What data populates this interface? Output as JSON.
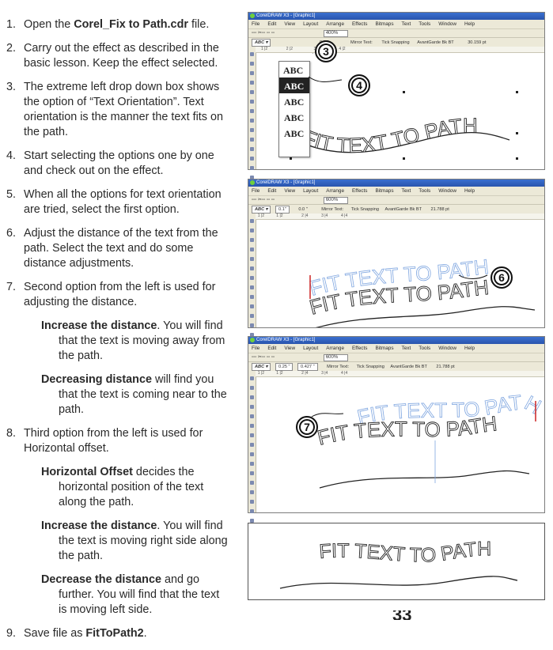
{
  "steps": [
    {
      "num": "1.",
      "parts": [
        {
          "t": "Open the "
        },
        {
          "t": "Corel_Fix to Path.cdr",
          "b": true
        },
        {
          "t": " file."
        }
      ]
    },
    {
      "num": "2.",
      "parts": [
        {
          "t": "Carry out the effect as described in the basic lesson. Keep the effect selected."
        }
      ]
    },
    {
      "num": "3.",
      "parts": [
        {
          "t": "The extreme left drop down box shows the option of “Text Orientation”. Text orientation is the manner the text fits on the path."
        }
      ]
    },
    {
      "num": "4.",
      "parts": [
        {
          "t": "Start selecting the options one by one and check out on the effect."
        }
      ]
    },
    {
      "num": "5.",
      "parts": [
        {
          "t": "When all the options for text orientation are tried, select the first option."
        }
      ]
    },
    {
      "num": "6.",
      "parts": [
        {
          "t": "Adjust the distance of the text from the path. Select the text and do some distance adjustments."
        }
      ]
    },
    {
      "num": "7.",
      "parts": [
        {
          "t": "Second option from the left is used for adjusting the distance."
        }
      ],
      "subs": [
        [
          {
            "t": "Increase the distance",
            "b": true
          },
          {
            "t": ". You will find that the text is moving away from the path."
          }
        ],
        [
          {
            "t": "Decreasing distance",
            "b": true
          },
          {
            "t": " will find you that the text is coming near to the path."
          }
        ]
      ]
    },
    {
      "num": "8.",
      "parts": [
        {
          "t": "Third option from the left is used for Horizontal offset."
        }
      ],
      "subs": [
        [
          {
            "t": "Horizontal Offset",
            "b": true
          },
          {
            "t": " decides the horizontal position of the text along the path."
          }
        ],
        [
          {
            "t": "Increase the distance",
            "b": true
          },
          {
            "t": ". You will find the text is moving right side along the path."
          }
        ],
        [
          {
            "t": "Decrease the distance",
            "b": true
          },
          {
            "t": " and go further. You will find that the text is moving left side."
          }
        ]
      ]
    },
    {
      "num": "9.",
      "parts": [
        {
          "t": "Save file as "
        },
        {
          "t": "FitToPath2",
          "b": true
        },
        {
          "t": "."
        }
      ]
    }
  ],
  "app": {
    "title": "CorelDRAW X3 - [Graphic1]",
    "menu": [
      "File",
      "Edit",
      "View",
      "Layout",
      "Arrange",
      "Effects",
      "Bitmaps",
      "Text",
      "Tools",
      "Window",
      "Help"
    ],
    "zoom1": "400%",
    "zoom2": "600%",
    "font": "AvantGarde Bk BT",
    "size1": "30.159 pt",
    "size2": "21.788 pt",
    "mirror": "Mirror Text:",
    "tick": "Tick Snapping",
    "dist1": "0.1\"",
    "dist2": "0.25 \"",
    "off1": "0.0 \"",
    "off3": "0.427 \""
  },
  "art": {
    "text": "FIT TEXT TO PATH",
    "abc": "ABC"
  },
  "callouts": {
    "c3": "3",
    "c4": "4",
    "c6": "6",
    "c7": "7"
  },
  "page_number": "33"
}
